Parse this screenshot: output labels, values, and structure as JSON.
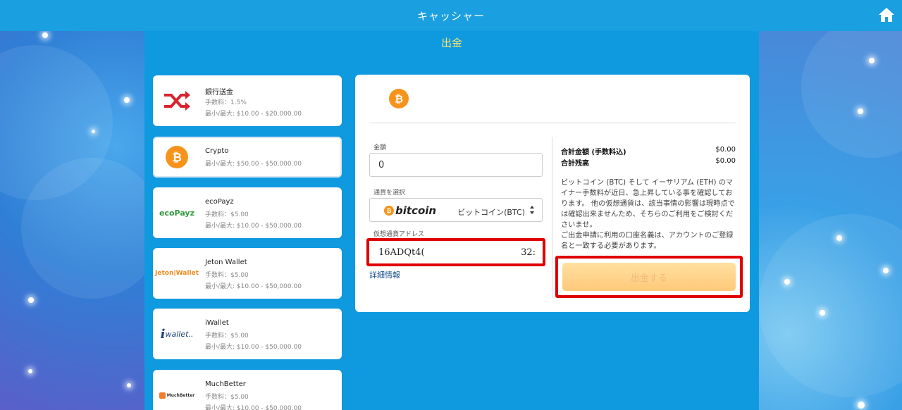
{
  "header": {
    "title": "キャッシャー"
  },
  "page": {
    "title": "出金"
  },
  "methods": [
    {
      "name": "銀行送金",
      "fee": "手数料：1.5%",
      "limit": "最小/最大: $10.00 - $20,000.00",
      "icon": "bank-transfer-shuffle-icon"
    },
    {
      "name": "Crypto",
      "limit": "最小/最大: $50.00 - $50,000.00",
      "icon": "bitcoin-icon",
      "selected": true
    },
    {
      "name": "ecoPayz",
      "fee": "手数料：$5.00",
      "limit": "最小/最大: $10.00 - $50,000.00",
      "logo_text": "ecoPayz"
    },
    {
      "name": "Jeton Wallet",
      "fee": "手数料：$5.00",
      "limit": "最小/最大: $10.00 - $50,000.00",
      "logo_text": "Jeton|Wallet"
    },
    {
      "name": "iWallet",
      "fee": "手数料：$5.00",
      "limit": "最小/最大: $10.00 - $50,000.00",
      "logo_text": "wallet.."
    },
    {
      "name": "MuchBetter",
      "fee": "手数料：$5.00",
      "limit": "最小/最大: $10.00 - $50,000.00",
      "logo_text": "MuchBetter"
    }
  ],
  "form": {
    "amount_label": "金額",
    "amount_value": "0",
    "currency_label": "通貨を選択",
    "currency_logo_text": "bitcoin",
    "currency_value": "ビットコイン(BTC)",
    "address_label": "仮想通貨アドレス",
    "address_start": "16ADQt4(",
    "address_end": "32:",
    "details_link": "詳細情報"
  },
  "summary": {
    "total_label": "合計金額 (手数料込)",
    "total_value": "$0.00",
    "balance_label": "合計残高",
    "balance_value": "$0.00",
    "notice_1": "ビットコイン (BTC) そして イーサリアム (ETH) のマイナー手数料が近日、急上昇している事を確認しております。 他の仮想通貨は、該当事情の影響は現時点では確認出来ませんため、そちらのご利用をご検討くださいませ。",
    "notice_2": "ご出金申請に利用の口座名義は、アカウントのご登録名と一致する必要があります。",
    "submit_label": "出金する"
  },
  "colors": {
    "accent": "#1a9fe0",
    "highlight": "#e00000",
    "bitcoin": "#f7931a",
    "title": "#ffe66b"
  }
}
